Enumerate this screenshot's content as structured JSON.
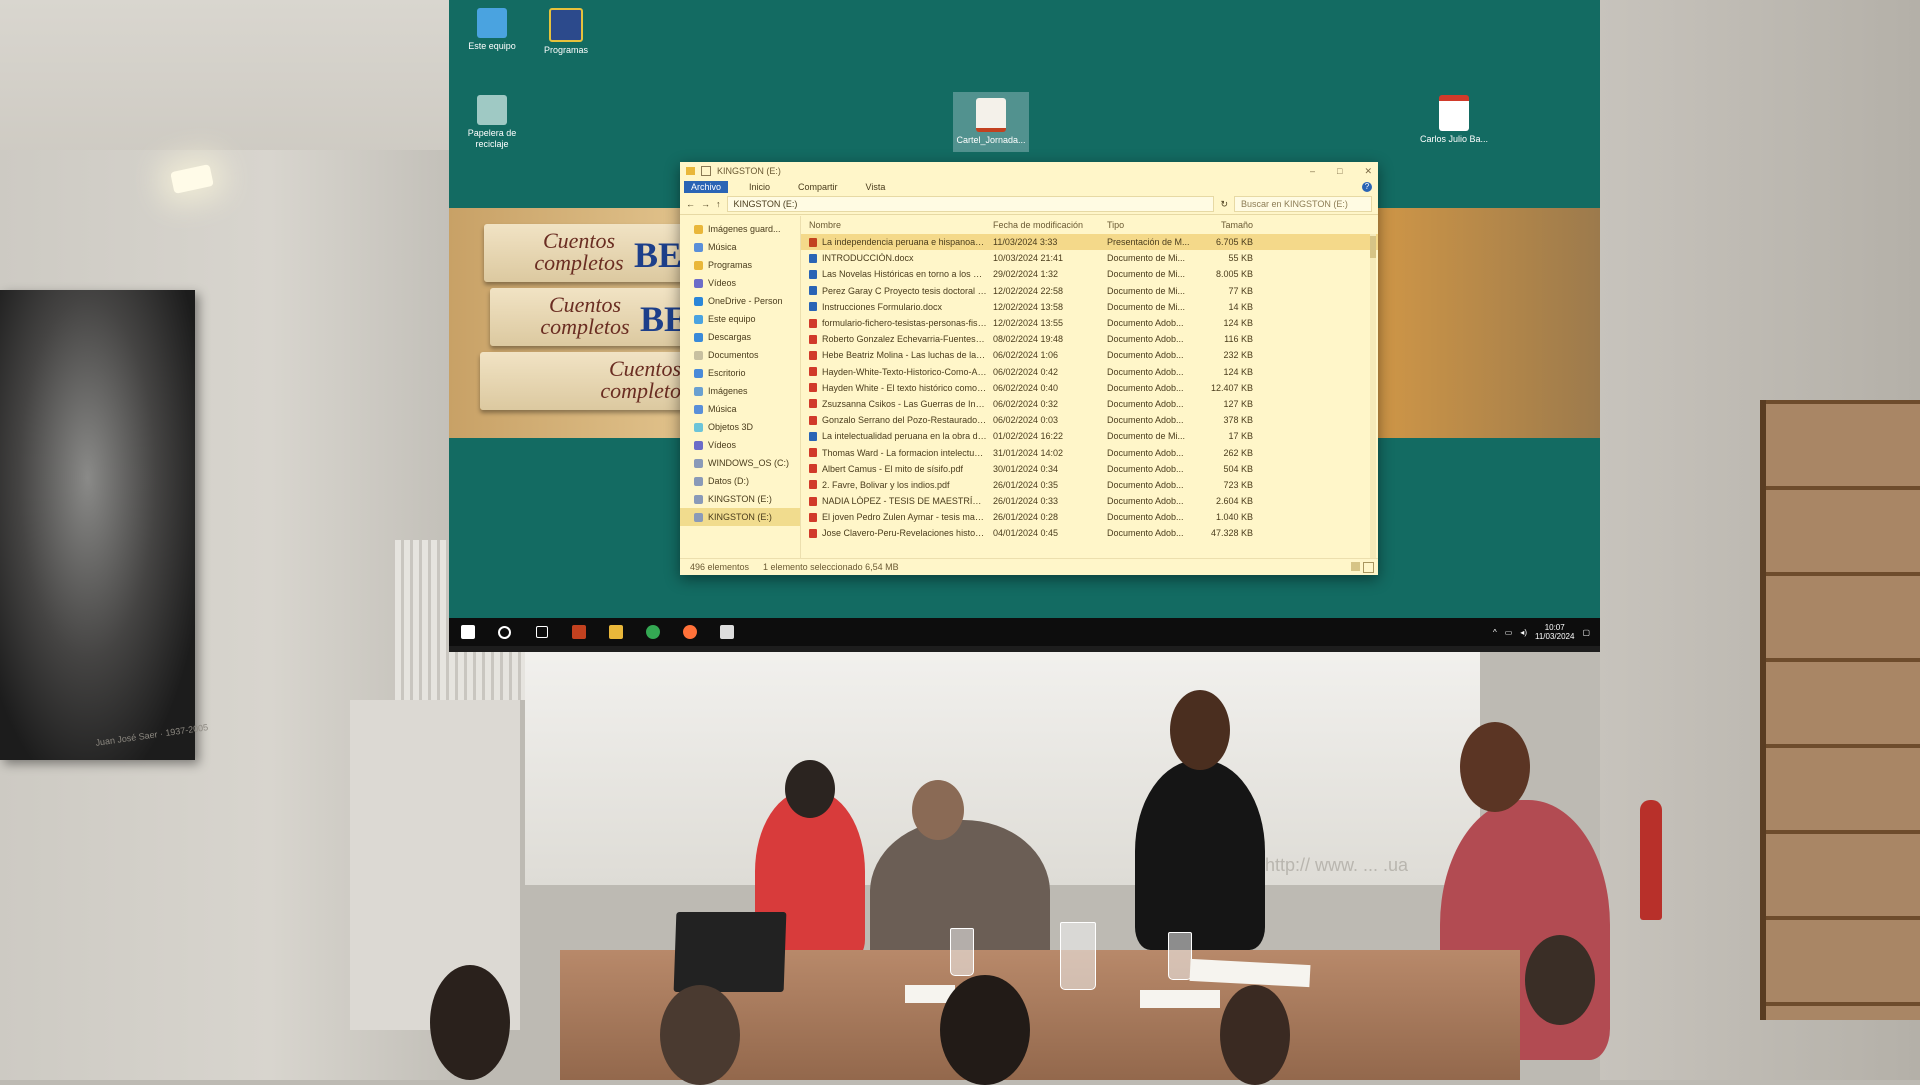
{
  "desktop": {
    "icons": [
      {
        "label": "Este equipo",
        "icon": "computer-icon"
      },
      {
        "label": "Programas",
        "icon": "shortcut-icon"
      },
      {
        "label": "Papelera de reciclaje",
        "icon": "recycle-bin-icon"
      },
      {
        "label": "Carlos Julio Ba...",
        "icon": "pdf-file-icon"
      },
      {
        "label": "Cartel_Jornada...",
        "icon": "presentation-file-icon"
      }
    ],
    "wallpaper_books": [
      "Cuentos completos",
      "Cuentos completos",
      "Cuentos completos"
    ],
    "wallpaper_author_fragment": "BEN"
  },
  "explorer": {
    "title": "KINGSTON (E:)",
    "ribbon_tabs": [
      "Archivo",
      "Inicio",
      "Compartir",
      "Vista"
    ],
    "address_path": "KINGSTON (E:)",
    "search_placeholder": "Buscar en KINGSTON (E:)",
    "nav": [
      "Imágenes guard...",
      "Música",
      "Programas",
      "Vídeos",
      "OneDrive - Person",
      "Este equipo",
      "Descargas",
      "Documentos",
      "Escritorio",
      "Imágenes",
      "Música",
      "Objetos 3D",
      "Vídeos",
      "WINDOWS_OS (C:)",
      "Datos (D:)",
      "KINGSTON (E:)",
      "KINGSTON (E:)"
    ],
    "columns": [
      "Nombre",
      "Fecha de modificación",
      "Tipo",
      "Tamaño"
    ],
    "files": [
      {
        "name": "La independencia peruana e hispanoame...",
        "date": "11/03/2024 3:33",
        "type": "Presentación de M...",
        "size": "6.705 KB",
        "kind": "ppt"
      },
      {
        "name": "INTRODUCCIÓN.docx",
        "date": "10/03/2024 21:41",
        "type": "Documento de Mi...",
        "size": "55 KB",
        "kind": "doc"
      },
      {
        "name": "Las Novelas Históricas en torno a los Lib...",
        "date": "29/02/2024 1:32",
        "type": "Documento de Mi...",
        "size": "8.005 KB",
        "kind": "doc"
      },
      {
        "name": "Perez Garay C Proyecto tesis doctoral His...",
        "date": "12/02/2024 22:58",
        "type": "Documento de Mi...",
        "size": "77 KB",
        "kind": "doc"
      },
      {
        "name": "Instrucciones Formulario.docx",
        "date": "12/02/2024 13:58",
        "type": "Documento de Mi...",
        "size": "14 KB",
        "kind": "doc"
      },
      {
        "name": "formulario-fichero-tesistas-personas-fisi...",
        "date": "12/02/2024 13:55",
        "type": "Documento Adob...",
        "size": "124 KB",
        "kind": "pdf"
      },
      {
        "name": "Roberto Gonzalez Echevarria-Fuentes.pdf",
        "date": "08/02/2024 19:48",
        "type": "Documento Adob...",
        "size": "116 KB",
        "kind": "pdf"
      },
      {
        "name": "Hebe Beatriz Molina - Las luchas de la In...",
        "date": "06/02/2024 1:06",
        "type": "Documento Adob...",
        "size": "232 KB",
        "kind": "pdf"
      },
      {
        "name": "Hayden-White-Texto-Historico-Como-Ar...",
        "date": "06/02/2024 0:42",
        "type": "Documento Adob...",
        "size": "124 KB",
        "kind": "pdf"
      },
      {
        "name": "Hayden White - El texto histórico como-...",
        "date": "06/02/2024 0:40",
        "type": "Documento Adob...",
        "size": "12.407 KB",
        "kind": "pdf"
      },
      {
        "name": "Zsuzsanna Csikos - Las Guerras de Indepe...",
        "date": "06/02/2024 0:32",
        "type": "Documento Adob...",
        "size": "127 KB",
        "kind": "pdf"
      },
      {
        "name": "Gonzalo Serrano del Pozo-Restaurador o...",
        "date": "06/02/2024 0:03",
        "type": "Documento Adob...",
        "size": "378 KB",
        "kind": "pdf"
      },
      {
        "name": "La intelectualidad peruana en la obra de ...",
        "date": "01/02/2024 16:22",
        "type": "Documento de Mi...",
        "size": "17 KB",
        "kind": "doc"
      },
      {
        "name": "Thomas Ward - La formacion intelectual ...",
        "date": "31/01/2024 14:02",
        "type": "Documento Adob...",
        "size": "262 KB",
        "kind": "pdf"
      },
      {
        "name": "Albert Camus - El mito de sísifo.pdf",
        "date": "30/01/2024 0:34",
        "type": "Documento Adob...",
        "size": "504 KB",
        "kind": "pdf"
      },
      {
        "name": "2. Favre, Bolivar y los indios.pdf",
        "date": "26/01/2024 0:35",
        "type": "Documento Adob...",
        "size": "723 KB",
        "kind": "pdf"
      },
      {
        "name": "NADIA LÓPEZ - TESIS DE MAESTRÍA.pdf",
        "date": "26/01/2024 0:33",
        "type": "Documento Adob...",
        "size": "2.604 KB",
        "kind": "pdf"
      },
      {
        "name": "El joven Pedro Zulen Aymar - tesis maest...",
        "date": "26/01/2024 0:28",
        "type": "Documento Adob...",
        "size": "1.040 KB",
        "kind": "pdf"
      },
      {
        "name": "Jose Clavero-Peru-Revelaciones historica...",
        "date": "04/01/2024 0:45",
        "type": "Documento Adob...",
        "size": "47.328 KB",
        "kind": "pdf"
      }
    ],
    "status_count": "496 elementos",
    "status_selected": "1 elemento seleccionado  6,54 MB"
  },
  "taskbar": {
    "apps": [
      "start-icon",
      "search-icon",
      "task-view-icon",
      "powerpoint-icon",
      "file-explorer-icon",
      "chrome-icon",
      "firefox-icon",
      "media-player-icon"
    ],
    "time": "10:07",
    "date": "11/03/2024"
  },
  "room": {
    "portrait_caption": "Juan José Saer · 1937-2005",
    "screen_url_fragment": "http:// www. ... .ua"
  },
  "colors": {
    "desktop_bg": "#136b62",
    "explorer_bg": "#fff6c9",
    "selection": "#f4d98a",
    "accent": "#2a64b5"
  }
}
